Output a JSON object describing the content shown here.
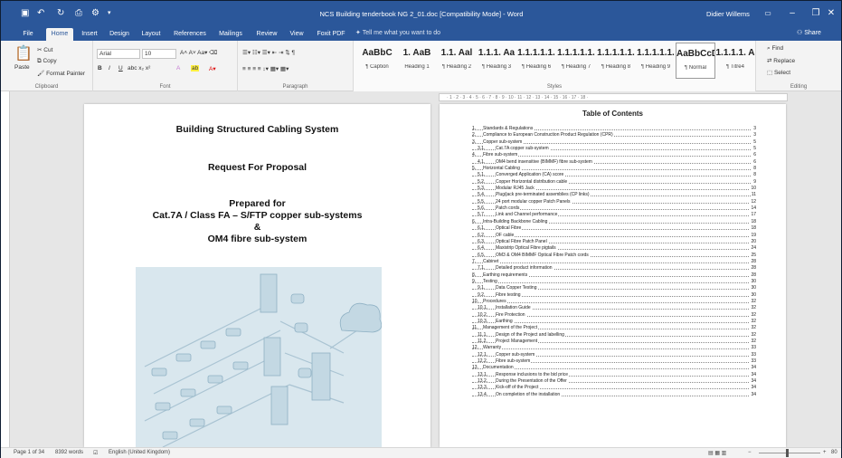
{
  "window": {
    "title": "NCS Building tenderbook NG 2_01.doc [Compatibility Mode]  -  Word",
    "user": "Didier Willems"
  },
  "menu": {
    "tabs": [
      "File",
      "Home",
      "Insert",
      "Design",
      "Layout",
      "References",
      "Mailings",
      "Review",
      "View",
      "Foxit PDF"
    ],
    "active": "Home",
    "tell_me": "Tell me what you want to do",
    "share": "Share"
  },
  "ribbon": {
    "clipboard": {
      "label": "Clipboard",
      "paste": "Paste",
      "cut": "Cut",
      "copy": "Copy",
      "format_painter": "Format Painter"
    },
    "font": {
      "label": "Font",
      "name": "Arial",
      "size": "10"
    },
    "paragraph": {
      "label": "Paragraph"
    },
    "styles": {
      "label": "Styles",
      "items": [
        {
          "preview": "AaBbC",
          "name": "¶ Caption"
        },
        {
          "preview": "1. AaB",
          "name": "Heading 1"
        },
        {
          "preview": "1.1. Aal",
          "name": "¶ Heading 2"
        },
        {
          "preview": "1.1.1. Aa",
          "name": "¶ Heading 3"
        },
        {
          "preview": "1.1.1.1.1.",
          "name": "¶ Heading 6"
        },
        {
          "preview": "1.1.1.1.1.",
          "name": "¶ Heading 7"
        },
        {
          "preview": "1.1.1.1.1.",
          "name": "¶ Heading 8"
        },
        {
          "preview": "1.1.1.1.1.",
          "name": "¶ Heading 9"
        },
        {
          "preview": "AaBbCcD",
          "name": "¶ Normal"
        },
        {
          "preview": "1.1.1.1. A",
          "name": "¶ Titre4"
        }
      ],
      "selected": "¶ Normal"
    },
    "editing": {
      "label": "Editing",
      "find": "Find",
      "replace": "Replace",
      "select": "Select"
    }
  },
  "page1": {
    "title": "Building Structured Cabling System",
    "subtitle": "Request For Proposal",
    "prepared": "Prepared for",
    "line1": "Cat.7A / Class FA – S/FTP copper sub-systems",
    "amp": "&",
    "line2": "OM4 fibre sub-system"
  },
  "page2": {
    "toc_title": "Table of Contents",
    "toc": [
      {
        "n": "1.",
        "t": "Standards & Regulations",
        "p": "3",
        "l": 0
      },
      {
        "n": "2.",
        "t": "Compliance to European Construction Product Regulation (CPR)",
        "p": "3",
        "l": 0
      },
      {
        "n": "3.",
        "t": "Copper sub-system",
        "p": "5",
        "l": 0
      },
      {
        "n": "3.1.",
        "t": "Cat.7A copper sub-system",
        "p": "5",
        "l": 1
      },
      {
        "n": "4.",
        "t": "Fibre sub-system",
        "p": "6",
        "l": 0
      },
      {
        "n": "4.1.",
        "t": "OM4 bend insensitive (BIMMF) fibre sub-system",
        "p": "6",
        "l": 1
      },
      {
        "n": "5.",
        "t": "Horizontal Cabling",
        "p": "8",
        "l": 0
      },
      {
        "n": "5.1.",
        "t": "Converged Application (CA) score",
        "p": "8",
        "l": 1
      },
      {
        "n": "5.2.",
        "t": "Copper Horizontal distribution cable",
        "p": "9",
        "l": 1
      },
      {
        "n": "5.3.",
        "t": "Modular RJ45 Jack",
        "p": "10",
        "l": 1
      },
      {
        "n": "5.4.",
        "t": "Plug/jack pre-terminated assemblies (CP links)",
        "p": "11",
        "l": 1
      },
      {
        "n": "5.5.",
        "t": "24 port modular copper Patch Panels",
        "p": "12",
        "l": 1
      },
      {
        "n": "5.6.",
        "t": "Patch cords",
        "p": "14",
        "l": 1
      },
      {
        "n": "5.7.",
        "t": "Link and Channel performance",
        "p": "17",
        "l": 1
      },
      {
        "n": "6.",
        "t": "Intra-Building Backbone Cabling",
        "p": "18",
        "l": 0
      },
      {
        "n": "6.1.",
        "t": "Optical Fibre",
        "p": "18",
        "l": 1
      },
      {
        "n": "6.2.",
        "t": "OF cable",
        "p": "19",
        "l": 1
      },
      {
        "n": "6.3.",
        "t": "Optical Fibre Patch Panel",
        "p": "20",
        "l": 1
      },
      {
        "n": "6.4.",
        "t": "Maxistrip Optical Fibre pigtails",
        "p": "24",
        "l": 1
      },
      {
        "n": "6.5.",
        "t": "OM3 & OM4 BIMMF Optical Fibre Patch cords",
        "p": "25",
        "l": 1
      },
      {
        "n": "7.",
        "t": "Cabinet",
        "p": "28",
        "l": 0
      },
      {
        "n": "7.1.",
        "t": "Detailed product information",
        "p": "28",
        "l": 1
      },
      {
        "n": "8.",
        "t": "Earthing requirements",
        "p": "28",
        "l": 0
      },
      {
        "n": "9.",
        "t": "Testing",
        "p": "30",
        "l": 0
      },
      {
        "n": "9.1.",
        "t": "Data Copper Testing",
        "p": "30",
        "l": 1
      },
      {
        "n": "9.2.",
        "t": "Fibre testing",
        "p": "30",
        "l": 1
      },
      {
        "n": "10.",
        "t": "Procedures",
        "p": "32",
        "l": 0
      },
      {
        "n": "10.1.",
        "t": "Installation Guide",
        "p": "32",
        "l": 1
      },
      {
        "n": "10.2.",
        "t": "Fire Protection",
        "p": "32",
        "l": 1
      },
      {
        "n": "10.3.",
        "t": "Earthing",
        "p": "32",
        "l": 1
      },
      {
        "n": "11.",
        "t": "Management of the Project",
        "p": "32",
        "l": 0
      },
      {
        "n": "11.1.",
        "t": "Design of the Project and labelling",
        "p": "32",
        "l": 1
      },
      {
        "n": "11.2.",
        "t": "Project Management",
        "p": "32",
        "l": 1
      },
      {
        "n": "12.",
        "t": "Warranty",
        "p": "33",
        "l": 0
      },
      {
        "n": "12.1.",
        "t": "Copper sub-system",
        "p": "33",
        "l": 1
      },
      {
        "n": "12.2.",
        "t": "Fibre sub-system",
        "p": "33",
        "l": 1
      },
      {
        "n": "13.",
        "t": "Documentation",
        "p": "34",
        "l": 0
      },
      {
        "n": "13.1.",
        "t": "Response inclusions to the bid price",
        "p": "34",
        "l": 1
      },
      {
        "n": "13.2.",
        "t": "During the Presentation of the Offer",
        "p": "34",
        "l": 1
      },
      {
        "n": "13.3.",
        "t": "Kick-off of the Project",
        "p": "34",
        "l": 1
      },
      {
        "n": "13.4.",
        "t": "On completion of the installation",
        "p": "34",
        "l": 1
      }
    ]
  },
  "status": {
    "page": "Page 1 of 34",
    "words": "8392 words",
    "language": "English (United Kingdom)",
    "zoom": "80"
  }
}
